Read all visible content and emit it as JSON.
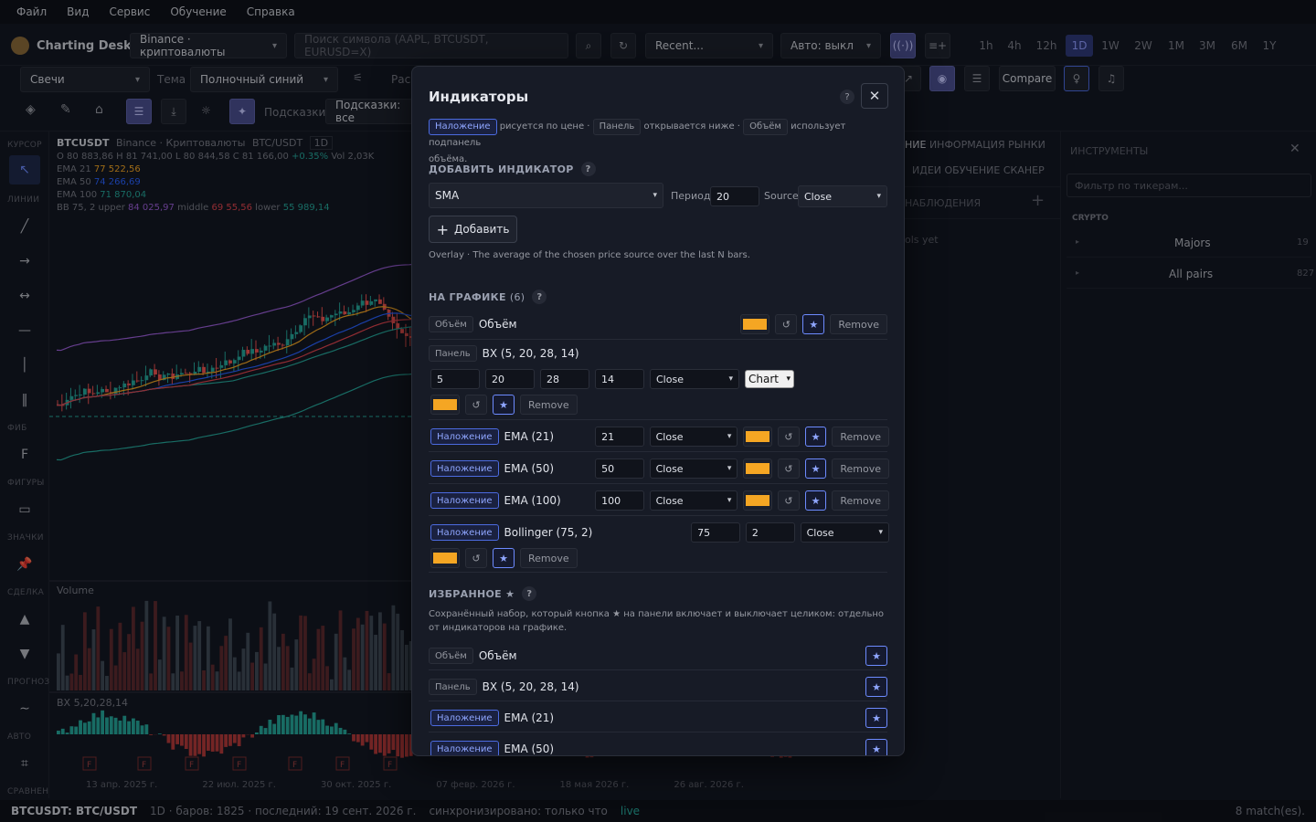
{
  "menu": [
    "Файл",
    "Вид",
    "Сервис",
    "Обучение",
    "Справка"
  ],
  "app": {
    "name": "Charting Desk",
    "exchange": "Binance · криптовалюты",
    "search_placeholder": "Поиск символа (AAPL, BTCUSDT, EURUSD=X)",
    "recent": "Recent...",
    "auto": "Авто: выкл"
  },
  "timeframes": [
    "1h",
    "4h",
    "12h",
    "1D",
    "1W",
    "2W",
    "1M",
    "3M",
    "6M",
    "1Y"
  ],
  "active_tf": "1D",
  "bar2": {
    "chart_type": "Свечи",
    "theme_label": "Тема",
    "theme": "Полночный синий",
    "partial": "Рас",
    "compare": "Compare"
  },
  "bar3": {
    "hints_label": "Подсказки",
    "hints_value": "Подсказки: все"
  },
  "left_tools": {
    "labels": [
      "КУРСОР",
      "ЛИНИИ",
      "ФИБ",
      "ФИГУРЫ",
      "ЗНАЧКИ",
      "СДЕЛКА",
      "ПРОГНОЗ",
      "АВТО",
      "СРАВНЕНИЕ"
    ]
  },
  "chart": {
    "symbol": "BTCUSDT",
    "exchange": "Binance · Криптовалюты",
    "pair": "BTC/USDT",
    "tf": "1D",
    "ohlc": {
      "o": "O 80 883,86",
      "h": "H 81 741,00",
      "l": "L 80 844,58",
      "c": "C 81 166,00",
      "chg": "+0.35%",
      "vol": "Vol 2,03K"
    },
    "ema21": "EMA 21",
    "ema21v": "77 522,56",
    "ema50": "EMA 50",
    "ema50v": "74 266,69",
    "ema100": "EMA 100",
    "ema100v": "71 870,04",
    "bb": "BB 75, 2",
    "bb_upper": "upper",
    "bb_upper_v": "84 025,97",
    "bb_middle": "middle",
    "bb_middle_v": "69 55,56",
    "bb_lower": "lower",
    "bb_lower_v": "55 989,14",
    "volume_label": "Volume",
    "bx_label": "BX 5,20,28,14",
    "dates": [
      "13 апр. 2025 г.",
      "22 июл. 2025 г.",
      "30 окт. 2025 г.",
      "07 февр. 2026 г.",
      "18 мая 2026 г.",
      "26 авг. 2026 г."
    ],
    "f_marker": "F"
  },
  "midpanel": {
    "tabs1": [
      "НИЕ",
      "ИНФОРМАЦИЯ",
      "РЫНКИ"
    ],
    "tabs2": [
      "ИДЕИ",
      "ОБУЧЕНИЕ",
      "СКАНЕР"
    ],
    "watch": "НАБЛЮДЕНИЯ",
    "empty": "ols yet"
  },
  "rightpanel": {
    "title": "ИНСТРУМЕНТЫ",
    "filter_placeholder": "Фильтр по тикерам...",
    "group": "CRYPTO",
    "items": [
      {
        "name": "Majors",
        "count": "19"
      },
      {
        "name": "All pairs",
        "count": "827"
      }
    ]
  },
  "status": {
    "symbol": "BTCUSDT: BTC/USDT",
    "info": "1D · баров: 1825 · последний: 19 сент. 2026 г.",
    "sync": "синхронизировано: только что",
    "live": "live",
    "matches": "8 match(es)."
  },
  "modal": {
    "title": "Индикаторы",
    "legend": {
      "t1": "Наложение",
      "d1": "рисуется по цене ·",
      "t2": "Панель",
      "d2": "открывается ниже ·",
      "t3": "Объём",
      "d3": "использует подпанель",
      "d4": "объёма."
    },
    "add_title": "ДОБАВИТЬ ИНДИКАТОР",
    "add_select": "SMA",
    "period_label": "Период",
    "period": "20",
    "source_label": "Source",
    "source": "Close",
    "add_btn": "Добавить",
    "add_desc": "Overlay · The average of the chosen price source over the last N bars.",
    "on_chart_title": "НА ГРАФИКЕ",
    "on_chart_count": "(6)",
    "remove": "Remove",
    "volume_row": {
      "tag": "Объём",
      "name": "Объём"
    },
    "bx_row": {
      "tag": "Панель",
      "name": "BX (5, 20, 28, 14)",
      "p1": "5",
      "p2": "20",
      "p3": "28",
      "p4": "14",
      "src": "Close",
      "pane": "Chart"
    },
    "ema_rows": [
      {
        "tag": "Наложение",
        "name": "EMA (21)",
        "period": "21",
        "src": "Close"
      },
      {
        "tag": "Наложение",
        "name": "EMA (50)",
        "period": "50",
        "src": "Close"
      },
      {
        "tag": "Наложение",
        "name": "EMA (100)",
        "period": "100",
        "src": "Close"
      }
    ],
    "bb_row": {
      "tag": "Наложение",
      "name": "Bollinger (75, 2)",
      "p1": "75",
      "p2": "2",
      "src": "Close"
    },
    "fav_title": "ИЗБРАННОЕ ★",
    "fav_desc": "Сохранённый набор, который кнопка ★ на панели включает и выключает целиком: отдельно от индикаторов на графике.",
    "favs": [
      {
        "tag": "Объём",
        "name": "Объём"
      },
      {
        "tag": "Панель",
        "name": "BX (5, 20, 28, 14)"
      },
      {
        "tag": "Наложение",
        "name": "EMA (21)"
      },
      {
        "tag": "Наложение",
        "name": "EMA (50)"
      }
    ],
    "accent": "#f5a623"
  }
}
